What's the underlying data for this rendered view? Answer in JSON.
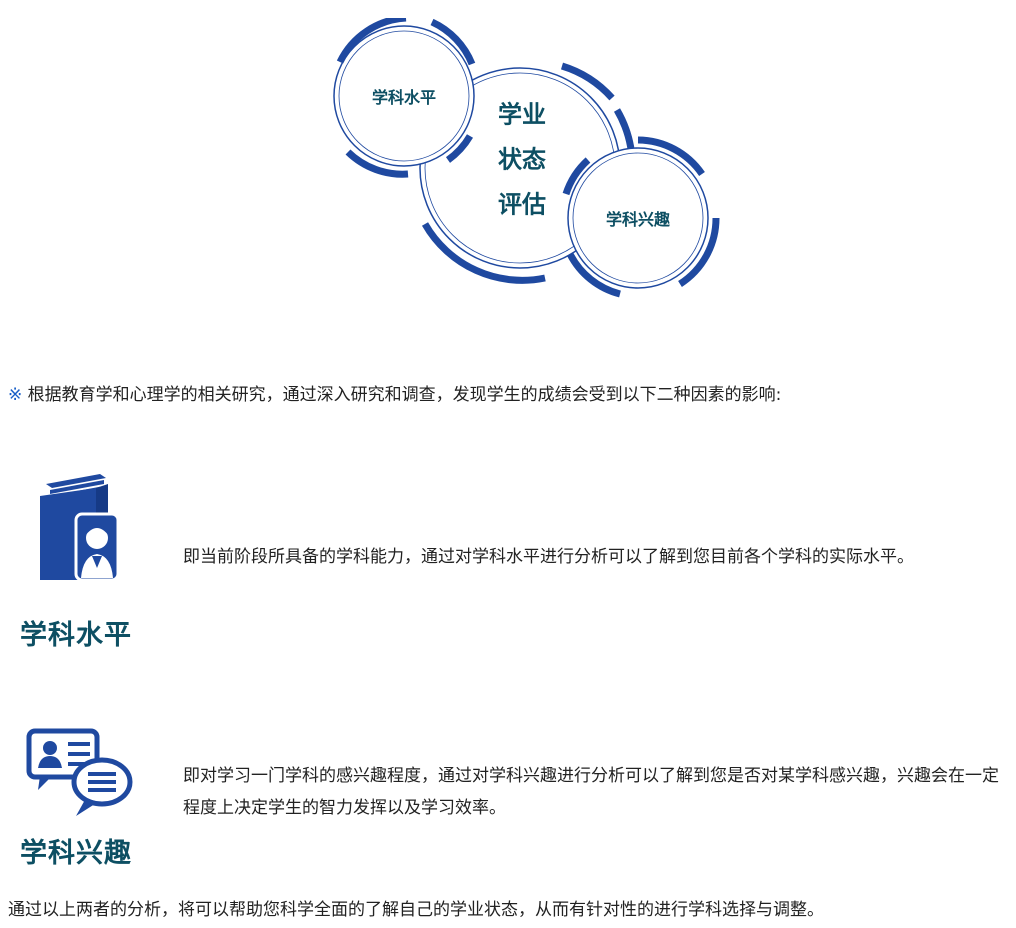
{
  "diagram": {
    "center_line1": "学业",
    "center_line2": "状态",
    "center_line3": "评估",
    "left_node": "学科水平",
    "right_node": "学科兴趣",
    "color": "#1f49a0",
    "text_color": "#0d4f63"
  },
  "intro": {
    "mark": "※",
    "text": " 根据教育学和心理学的相关研究，通过深入研究和调查，发现学生的成绩会受到以下二种因素的影响:"
  },
  "factors": [
    {
      "icon": "book-person-icon",
      "title": "学科水平",
      "desc": "即当前阶段所具备的学科能力，通过对学科水平进行分析可以了解到您目前各个学科的实际水平。"
    },
    {
      "icon": "profile-chat-icon",
      "title": "学科兴趣",
      "desc": "即对学习一门学科的感兴趣程度，通过对学科兴趣进行分析可以了解到您是否对某学科感兴趣，兴趣会在一定程度上决定学生的智力发挥以及学习效率。"
    }
  ],
  "summary": "通过以上两者的分析，将可以帮助您科学全面的了解自己的学业状态，从而有针对性的进行学科选择与调整。"
}
